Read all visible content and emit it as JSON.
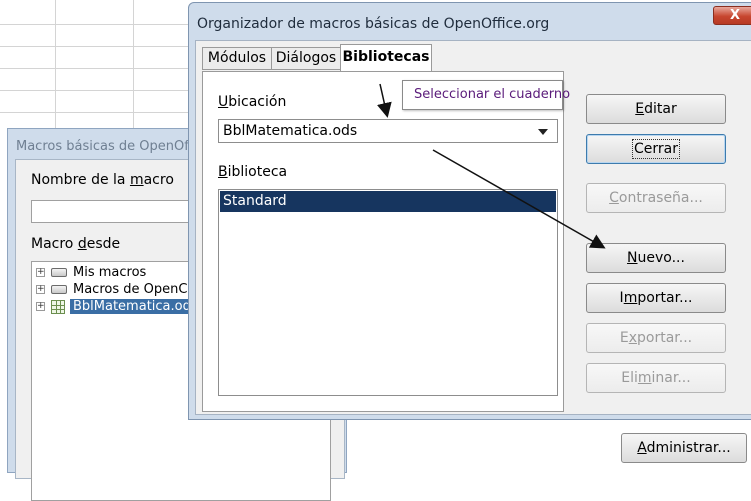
{
  "main_dialog": {
    "title": "Organizador de macros básicas de OpenOffice.org",
    "close_label": "X",
    "tabs": [
      {
        "label": "Módulos"
      },
      {
        "label": "Diálogos"
      },
      {
        "label": "Bibliotecas"
      }
    ],
    "location_label_u": "U",
    "location_label_rest": "bicación",
    "location_value": "BblMatematica.ods",
    "library_label_u": "B",
    "library_label_rest": "iblioteca",
    "libraries": [
      "Standard"
    ],
    "tooltip": "Seleccionar el cuaderno",
    "buttons": {
      "edit_u": "E",
      "edit_rest": "ditar",
      "close": "Cerrar",
      "password_u": "C",
      "password_rest": "ontraseña...",
      "new_u": "N",
      "new_rest": "uevo...",
      "import_pre": "I",
      "import_u": "m",
      "import_rest": "portar...",
      "export_pre": "E",
      "export_u": "x",
      "export_rest": "portar...",
      "delete_pre": "Eli",
      "delete_u": "m",
      "delete_rest": "inar..."
    }
  },
  "background_dialog": {
    "title": "Macros básicas de OpenOff",
    "macro_name_label_pre": "Nombre de la ",
    "macro_name_label_u": "m",
    "macro_name_label_rest": "acro",
    "macro_from_label_pre": "Macro ",
    "macro_from_label_u": "d",
    "macro_from_label_rest": "esde",
    "tree": [
      {
        "label": "Mis macros"
      },
      {
        "label": "Macros de OpenC"
      },
      {
        "label": "BblMatematica.od"
      }
    ],
    "admin_button_u": "A",
    "admin_button_rest": "dministrar..."
  }
}
